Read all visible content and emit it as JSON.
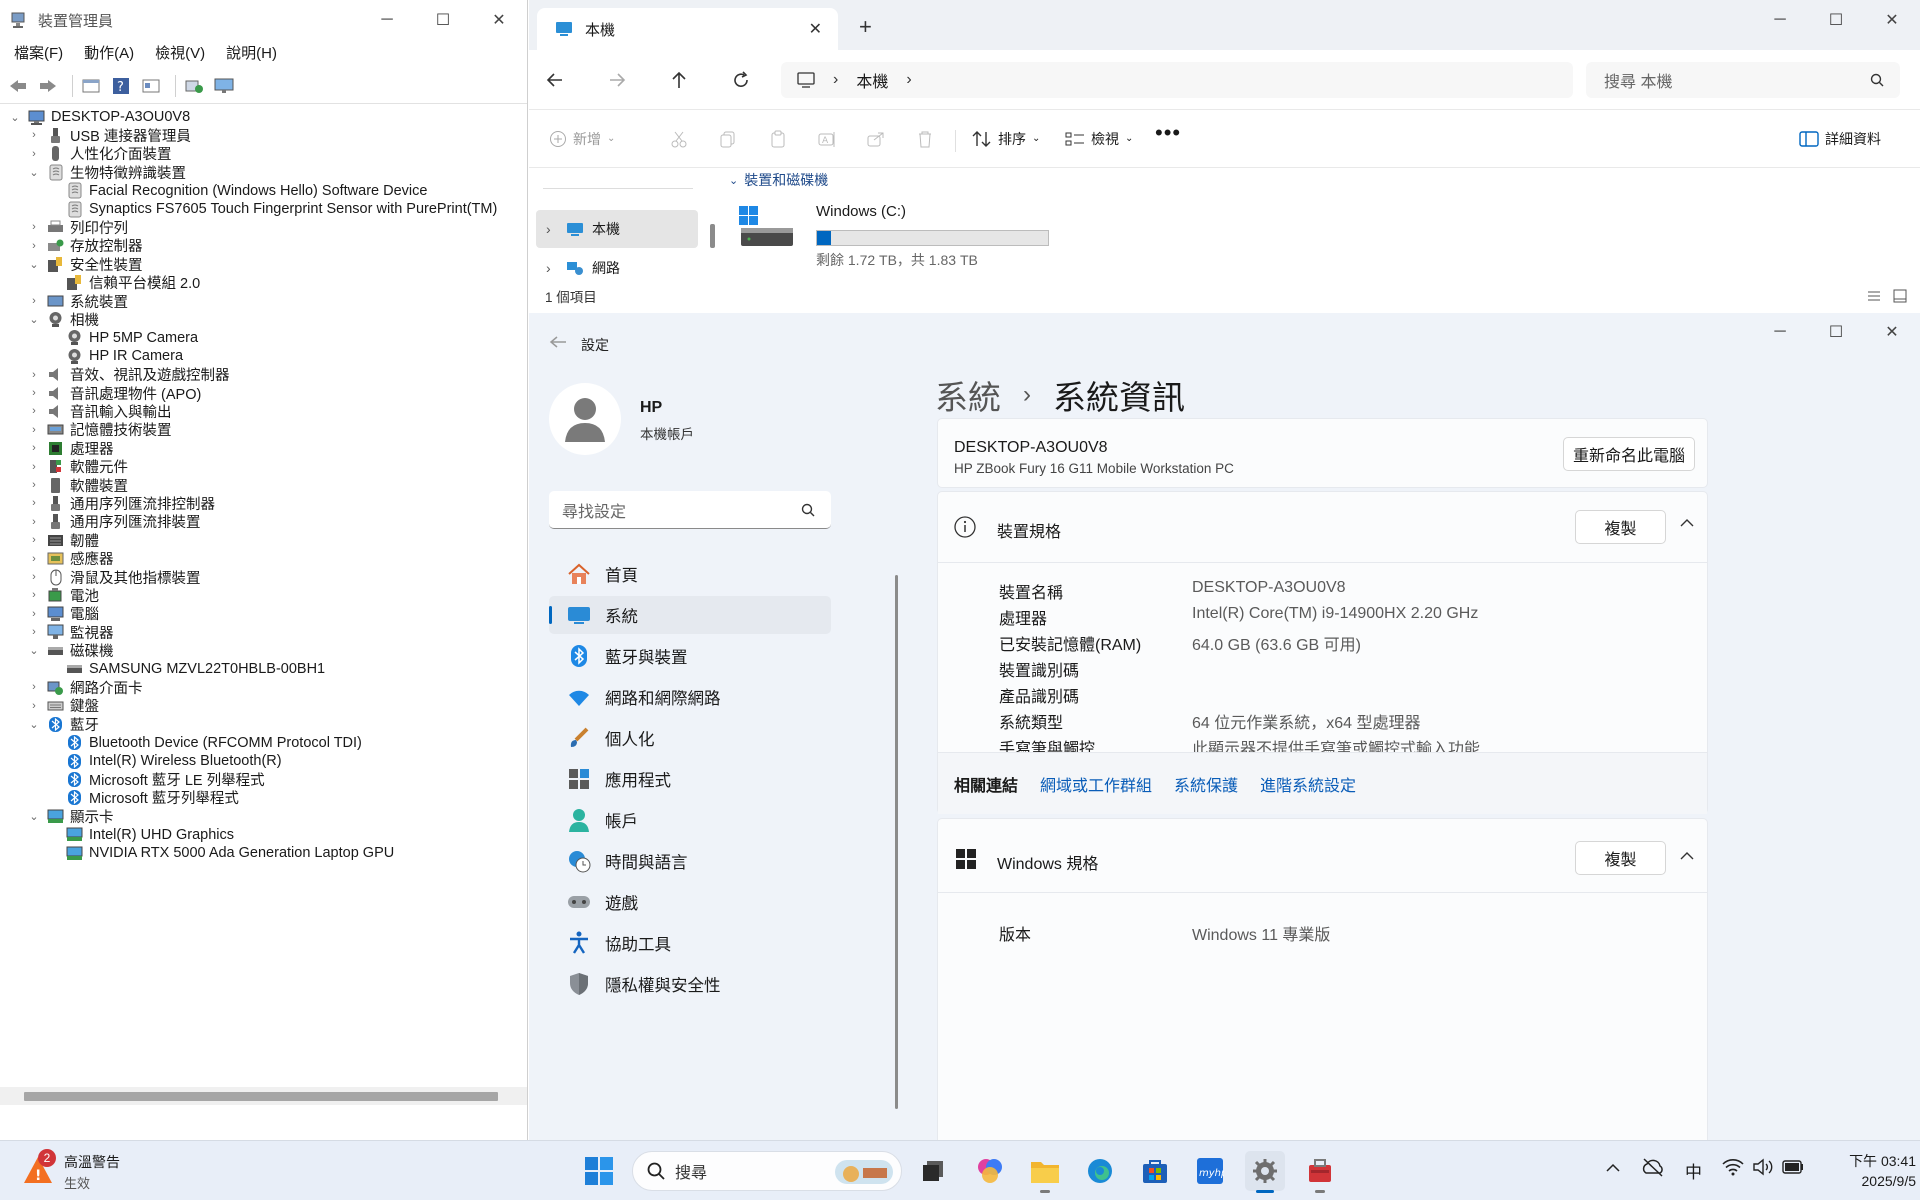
{
  "device_manager": {
    "title": "裝置管理員",
    "menu": [
      "檔案(F)",
      "動作(A)",
      "檢視(V)",
      "說明(H)"
    ],
    "root": "DESKTOP-A3OU0V8",
    "tree": [
      {
        "label": "USB 連接器管理員",
        "level": 1,
        "state": "collapsed",
        "icon": "usb-icon"
      },
      {
        "label": "人性化介面裝置",
        "level": 1,
        "state": "collapsed",
        "icon": "hid-icon"
      },
      {
        "label": "生物特徵辨識裝置",
        "level": 1,
        "state": "expanded",
        "icon": "biometric-icon"
      },
      {
        "label": "Facial Recognition (Windows Hello) Software Device",
        "level": 2,
        "state": "leaf",
        "icon": "biometric-icon"
      },
      {
        "label": "Synaptics FS7605 Touch Fingerprint Sensor with PurePrint(TM)",
        "level": 2,
        "state": "leaf",
        "icon": "biometric-icon"
      },
      {
        "label": "列印佇列",
        "level": 1,
        "state": "collapsed",
        "icon": "printer-icon"
      },
      {
        "label": "存放控制器",
        "level": 1,
        "state": "collapsed",
        "icon": "storage-controller-icon"
      },
      {
        "label": "安全性裝置",
        "level": 1,
        "state": "expanded",
        "icon": "security-icon"
      },
      {
        "label": "信賴平台模組 2.0",
        "level": 2,
        "state": "leaf",
        "icon": "security-icon"
      },
      {
        "label": "系統裝置",
        "level": 1,
        "state": "collapsed",
        "icon": "system-device-icon"
      },
      {
        "label": "相機",
        "level": 1,
        "state": "expanded",
        "icon": "camera-icon"
      },
      {
        "label": "HP 5MP Camera",
        "level": 2,
        "state": "leaf",
        "icon": "camera-icon"
      },
      {
        "label": "HP IR Camera",
        "level": 2,
        "state": "leaf",
        "icon": "camera-icon"
      },
      {
        "label": "音效、視訊及遊戲控制器",
        "level": 1,
        "state": "collapsed",
        "icon": "speaker-icon"
      },
      {
        "label": "音訊處理物件 (APO)",
        "level": 1,
        "state": "collapsed",
        "icon": "speaker-icon"
      },
      {
        "label": "音訊輸入與輸出",
        "level": 1,
        "state": "collapsed",
        "icon": "speaker-icon"
      },
      {
        "label": "記憶體技術裝置",
        "level": 1,
        "state": "collapsed",
        "icon": "memory-icon"
      },
      {
        "label": "處理器",
        "level": 1,
        "state": "collapsed",
        "icon": "processor-icon"
      },
      {
        "label": "軟體元件",
        "level": 1,
        "state": "collapsed",
        "icon": "software-component-icon"
      },
      {
        "label": "軟體裝置",
        "level": 1,
        "state": "collapsed",
        "icon": "software-device-icon"
      },
      {
        "label": "通用序列匯流排控制器",
        "level": 1,
        "state": "collapsed",
        "icon": "usb-icon"
      },
      {
        "label": "通用序列匯流排裝置",
        "level": 1,
        "state": "collapsed",
        "icon": "usb-icon"
      },
      {
        "label": "韌體",
        "level": 1,
        "state": "collapsed",
        "icon": "firmware-icon"
      },
      {
        "label": "感應器",
        "level": 1,
        "state": "collapsed",
        "icon": "sensor-icon"
      },
      {
        "label": "滑鼠及其他指標裝置",
        "level": 1,
        "state": "collapsed",
        "icon": "mouse-icon"
      },
      {
        "label": "電池",
        "level": 1,
        "state": "collapsed",
        "icon": "battery-icon"
      },
      {
        "label": "電腦",
        "level": 1,
        "state": "collapsed",
        "icon": "computer-icon"
      },
      {
        "label": "監視器",
        "level": 1,
        "state": "collapsed",
        "icon": "monitor-icon"
      },
      {
        "label": "磁碟機",
        "level": 1,
        "state": "expanded",
        "icon": "disk-icon"
      },
      {
        "label": "SAMSUNG MZVL22T0HBLB-00BH1",
        "level": 2,
        "state": "leaf",
        "icon": "disk-icon"
      },
      {
        "label": "網路介面卡",
        "level": 1,
        "state": "collapsed",
        "icon": "network-adapter-icon"
      },
      {
        "label": "鍵盤",
        "level": 1,
        "state": "collapsed",
        "icon": "keyboard-icon"
      },
      {
        "label": "藍牙",
        "level": 1,
        "state": "expanded",
        "icon": "bluetooth-icon"
      },
      {
        "label": "Bluetooth Device (RFCOMM Protocol TDI)",
        "level": 2,
        "state": "leaf",
        "icon": "bluetooth-icon"
      },
      {
        "label": "Intel(R) Wireless Bluetooth(R)",
        "level": 2,
        "state": "leaf",
        "icon": "bluetooth-icon"
      },
      {
        "label": "Microsoft 藍牙 LE 列舉程式",
        "level": 2,
        "state": "leaf",
        "icon": "bluetooth-icon"
      },
      {
        "label": "Microsoft 藍牙列舉程式",
        "level": 2,
        "state": "leaf",
        "icon": "bluetooth-icon"
      },
      {
        "label": "顯示卡",
        "level": 1,
        "state": "expanded",
        "icon": "display-adapter-icon"
      },
      {
        "label": "Intel(R) UHD Graphics",
        "level": 2,
        "state": "leaf",
        "icon": "display-adapter-icon"
      },
      {
        "label": "NVIDIA RTX 5000 Ada Generation Laptop GPU",
        "level": 2,
        "state": "leaf",
        "icon": "display-adapter-icon"
      }
    ]
  },
  "file_explorer": {
    "tab_title": "本機",
    "address": "本機",
    "search_placeholder": "搜尋 本機",
    "cmd_new": "新增",
    "cmd_sort": "排序",
    "cmd_view": "檢視",
    "cmd_details": "詳細資料",
    "nav_this_pc": "本機",
    "nav_network": "網路",
    "group_header": "裝置和磁碟機",
    "drive_name": "Windows (C:)",
    "drive_free": "剩餘 1.72 TB，共 1.83 TB",
    "drive_used_fraction": 0.06,
    "status": "1 個項目"
  },
  "settings": {
    "title": "設定",
    "user_name": "HP",
    "user_type": "本機帳戶",
    "search_placeholder": "尋找設定",
    "nav": [
      {
        "label": "首頁",
        "icon": "home-icon"
      },
      {
        "label": "系統",
        "icon": "system-icon",
        "active": true
      },
      {
        "label": "藍牙與裝置",
        "icon": "bluetooth-icon"
      },
      {
        "label": "網路和網際網路",
        "icon": "wifi-icon"
      },
      {
        "label": "個人化",
        "icon": "brush-icon"
      },
      {
        "label": "應用程式",
        "icon": "apps-icon"
      },
      {
        "label": "帳戶",
        "icon": "account-icon"
      },
      {
        "label": "時間與語言",
        "icon": "time-language-icon"
      },
      {
        "label": "遊戲",
        "icon": "gamepad-icon"
      },
      {
        "label": "協助工具",
        "icon": "accessibility-icon"
      },
      {
        "label": "隱私權與安全性",
        "icon": "shield-icon"
      }
    ],
    "breadcrumb_parent": "系統",
    "breadcrumb_current": "系統資訊",
    "device_name_header": "DESKTOP-A3OU0V8",
    "device_model": "HP ZBook Fury 16 G11 Mobile Workstation PC",
    "rename_button": "重新命名此電腦",
    "device_specs_title": "裝置規格",
    "copy_label": "複製",
    "specs": [
      {
        "k": "裝置名稱",
        "v": "DESKTOP-A3OU0V8"
      },
      {
        "k": "處理器",
        "v": "Intel(R) Core(TM) i9-14900HX   2.20 GHz"
      },
      {
        "k": "已安裝記憶體(RAM)",
        "v": "64.0 GB (63.6 GB 可用)"
      },
      {
        "k": "裝置識別碼",
        "v": ""
      },
      {
        "k": "產品識別碼",
        "v": ""
      },
      {
        "k": "系統類型",
        "v": "64 位元作業系統，x64 型處理器"
      },
      {
        "k": "手寫筆與觸控",
        "v": "此顯示器不提供手寫筆或觸控式輸入功能"
      }
    ],
    "related_links_label": "相關連結",
    "related_links": [
      "網域或工作群組",
      "系統保護",
      "進階系統設定"
    ],
    "windows_specs_title": "Windows 規格",
    "edition_key": "版本",
    "edition_value": "Windows 11 專業版"
  },
  "taskbar": {
    "alert_count": "2",
    "alert_title": "高溫警告",
    "alert_sub": "生效",
    "search_label": "搜尋",
    "ime": "中",
    "time": "下午 03:41",
    "date": "2025/9/5"
  },
  "colors": {
    "accent": "#0067c0",
    "link": "#0a5db8",
    "settings_bg": "#eff3f9"
  }
}
